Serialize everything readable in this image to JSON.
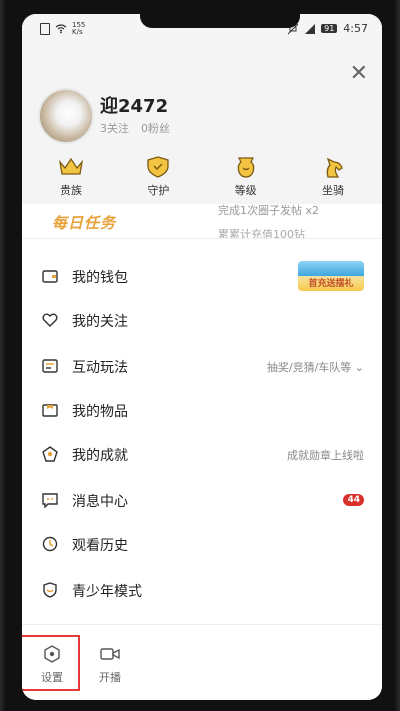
{
  "status_bar": {
    "net_speed_top": "155",
    "net_speed_bottom": "K/s",
    "battery": "91",
    "time": "4:57"
  },
  "profile": {
    "username": "迎2472",
    "follows": "3关注",
    "fans": "0粉丝"
  },
  "perks": [
    {
      "label": "贵族",
      "icon": "crown-icon"
    },
    {
      "label": "守护",
      "icon": "shield-icon"
    },
    {
      "label": "等级",
      "icon": "level-icon"
    },
    {
      "label": "坐骑",
      "icon": "horse-icon"
    }
  ],
  "daily_task": {
    "title": "每日任务",
    "line1": "完成1次圈子发帖",
    "line1_reward": "x2",
    "line2": "累累计充值100钻"
  },
  "menu": [
    {
      "label": "我的钱包",
      "icon": "wallet-icon",
      "promo": "首充送摆礼"
    },
    {
      "label": "我的关注",
      "icon": "heart-icon"
    },
    {
      "label": "互动玩法",
      "icon": "game-icon",
      "right": "抽奖/竞猜/车队等"
    },
    {
      "label": "我的物品",
      "icon": "box-icon"
    },
    {
      "label": "我的成就",
      "icon": "achievement-icon",
      "right": "成就勋章上线啦"
    },
    {
      "label": "消息中心",
      "icon": "message-icon",
      "badge": "44"
    },
    {
      "label": "观看历史",
      "icon": "clock-icon"
    },
    {
      "label": "青少年模式",
      "icon": "youth-shield-icon"
    }
  ],
  "bottom": {
    "settings": "设置",
    "broadcast": "开播"
  },
  "colors": {
    "gold": "#e8a23a",
    "badge": "#d9302c",
    "highlight": "#e23a3a"
  }
}
